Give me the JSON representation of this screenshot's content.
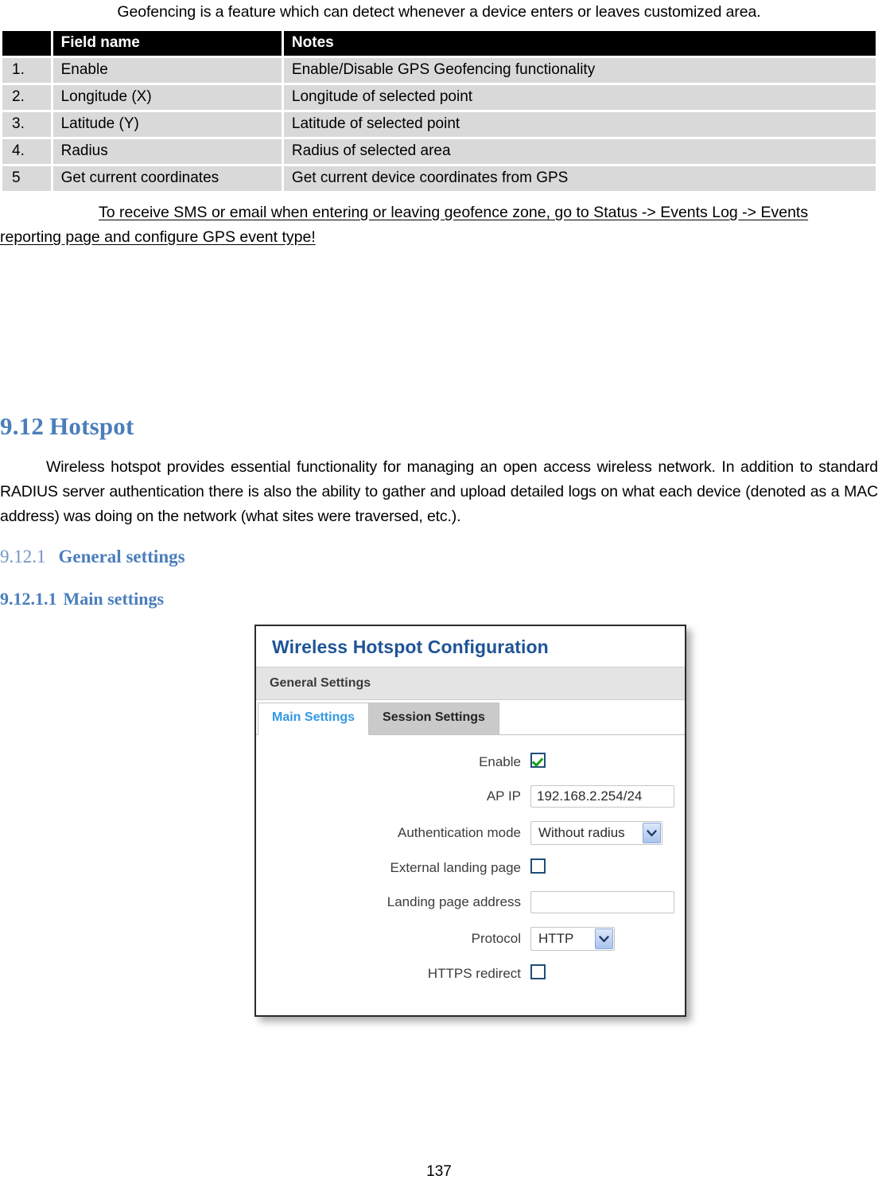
{
  "intro": {
    "text": "Geofencing is a feature which can detect whenever a device enters or leaves customized area."
  },
  "field_table": {
    "headers": [
      "",
      "Field name",
      "Notes"
    ],
    "rows": [
      {
        "num": "1.",
        "field": "Enable",
        "notes": "Enable/Disable GPS Geofencing functionality"
      },
      {
        "num": "2.",
        "field": "Longitude (X)",
        "notes": "Longitude of selected point"
      },
      {
        "num": "3.",
        "field": "Latitude (Y)",
        "notes": "Latitude of selected point"
      },
      {
        "num": "4.",
        "field": "Radius",
        "notes": "Radius of selected area"
      },
      {
        "num": "5",
        "field": "Get current coordinates",
        "notes": "Get current device coordinates from GPS"
      }
    ]
  },
  "note": {
    "text": "To receive SMS or email when entering or leaving geofence zone, go to Status -> Events Log -> Events reporting page and configure GPS event type!"
  },
  "headings": {
    "h2_number": "9.12",
    "h2_title": "Hotspot",
    "h3_number": "9.12.1",
    "h3_title": "General settings",
    "h4_number": "9.12.1.1",
    "h4_title": "Main settings"
  },
  "body_paragraph": {
    "text": "Wireless hotspot provides essential functionality for managing an open access wireless network. In addition to standard RADIUS server authentication there is also the ability to gather and upload detailed logs on what each device (denoted as a MAC address) was doing on the network (what sites were traversed, etc.)."
  },
  "ui_screenshot": {
    "title": "Wireless Hotspot Configuration",
    "section_bar": "General Settings",
    "tabs": [
      {
        "label": "Main Settings",
        "active": true
      },
      {
        "label": "Session Settings",
        "active": false
      }
    ],
    "fields": {
      "enable_label": "Enable",
      "enable_checked": true,
      "ap_ip_label": "AP IP",
      "ap_ip_value": "192.168.2.254/24",
      "auth_mode_label": "Authentication mode",
      "auth_mode_value": "Without radius",
      "external_landing_label": "External landing page",
      "external_landing_checked": false,
      "landing_address_label": "Landing page address",
      "landing_address_value": "",
      "protocol_label": "Protocol",
      "protocol_value": "HTTP",
      "https_redirect_label": "HTTPS redirect",
      "https_redirect_checked": false
    },
    "colors": {
      "title_blue": "#1f5496",
      "active_tab_blue": "#3399e6",
      "section_bar_gray": "#e4e4e4",
      "inactive_tab_gray": "#cacaca",
      "checkbox_border": "#1f4e79",
      "check_green": "#1a9e1a"
    }
  },
  "page_number": "137",
  "theme": {
    "heading_blue": "#4a7ebb",
    "table_header_bg": "#000000",
    "table_row_bg": "#d9d9d9"
  }
}
